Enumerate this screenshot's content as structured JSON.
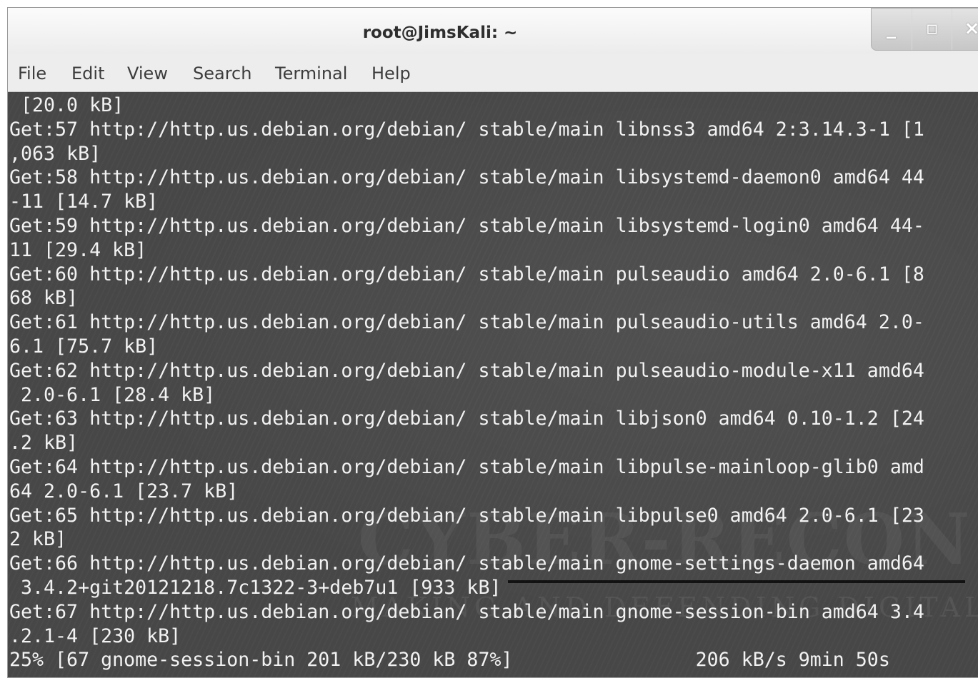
{
  "window": {
    "title": "root@JimsKali: ~",
    "controls": {
      "minimize": "_",
      "maximize": "▫",
      "close": "×"
    }
  },
  "menu": [
    "File",
    "Edit",
    "View",
    "Search",
    "Terminal",
    "Help"
  ],
  "terminal": {
    "lines": [
      " [20.0 kB]",
      "Get:57 http://http.us.debian.org/debian/ stable/main libnss3 amd64 2:3.14.3-1 [1",
      ",063 kB]",
      "Get:58 http://http.us.debian.org/debian/ stable/main libsystemd-daemon0 amd64 44",
      "-11 [14.7 kB]",
      "Get:59 http://http.us.debian.org/debian/ stable/main libsystemd-login0 amd64 44-",
      "11 [29.4 kB]",
      "Get:60 http://http.us.debian.org/debian/ stable/main pulseaudio amd64 2.0-6.1 [8",
      "68 kB]",
      "Get:61 http://http.us.debian.org/debian/ stable/main pulseaudio-utils amd64 2.0-",
      "6.1 [75.7 kB]",
      "Get:62 http://http.us.debian.org/debian/ stable/main pulseaudio-module-x11 amd64",
      " 2.0-6.1 [28.4 kB]",
      "Get:63 http://http.us.debian.org/debian/ stable/main libjson0 amd64 0.10-1.2 [24",
      ".2 kB]",
      "Get:64 http://http.us.debian.org/debian/ stable/main libpulse-mainloop-glib0 amd",
      "64 2.0-6.1 [23.7 kB]",
      "Get:65 http://http.us.debian.org/debian/ stable/main libpulse0 amd64 2.0-6.1 [23",
      "2 kB]",
      "Get:66 http://http.us.debian.org/debian/ stable/main gnome-settings-daemon amd64",
      " 3.4.2+git20121218.7c1322-3+deb7u1 [933 kB]",
      "Get:67 http://http.us.debian.org/debian/ stable/main gnome-session-bin amd64 3.4",
      ".2.1-4 [230 kB]",
      "25% [67 gnome-session-bin 201 kB/230 kB 87%]                206 kB/s 9min 50s"
    ]
  },
  "watermark": {
    "main": "CYBER-RECON",
    "sub": "MAKING AND DEFENDING DIGITAL TERRAIN"
  }
}
